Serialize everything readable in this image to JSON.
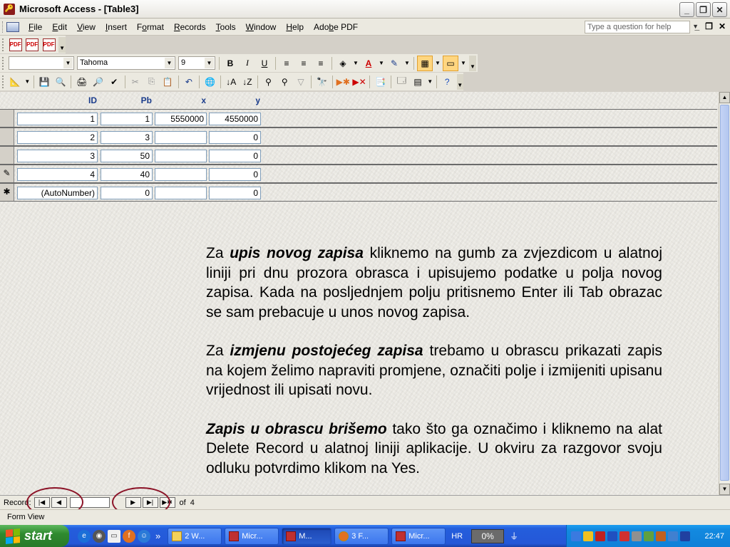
{
  "window": {
    "title": "Microsoft Access - [Table3]"
  },
  "menubar": {
    "items": [
      {
        "label": "File",
        "ul": "F",
        "rest": "ile"
      },
      {
        "label": "Edit",
        "ul": "E",
        "rest": "dit"
      },
      {
        "label": "View",
        "ul": "V",
        "rest": "iew"
      },
      {
        "label": "Insert",
        "ul": "I",
        "rest": "nsert"
      },
      {
        "label": "Format",
        "pre": "F",
        "ul": "o",
        "rest": "rmat"
      },
      {
        "label": "Records",
        "ul": "R",
        "rest": "ecords"
      },
      {
        "label": "Tools",
        "ul": "T",
        "rest": "ools"
      },
      {
        "label": "Window",
        "ul": "W",
        "rest": "indow"
      },
      {
        "label": "Help",
        "ul": "H",
        "rest": "elp"
      },
      {
        "label": "Adobe PDF",
        "pre": "Ado",
        "ul": "b",
        "rest": "e PDF"
      }
    ],
    "help_placeholder": "Type a question for help"
  },
  "format_toolbar": {
    "font": "Tahoma",
    "size": "9"
  },
  "table": {
    "columns": [
      "ID",
      "Pb",
      "x",
      "y"
    ],
    "rows": [
      {
        "selector": "",
        "ID": "1",
        "Pb": "1",
        "x": "5550000",
        "y": "4550000"
      },
      {
        "selector": "",
        "ID": "2",
        "Pb": "3",
        "x": "",
        "y": "0"
      },
      {
        "selector": "",
        "ID": "3",
        "Pb": "50",
        "x": "",
        "y": "0"
      },
      {
        "selector": "✎",
        "ID": "4",
        "Pb": "40",
        "x": "",
        "y": "0"
      },
      {
        "selector": "✱",
        "ID": "(AutoNumber)",
        "Pb": "0",
        "x": "",
        "y": "0"
      }
    ]
  },
  "info": {
    "p1_pre": "Za ",
    "p1_bold": "upis novog zapisa",
    "p1_post": " kliknemo na gumb za zvjezdicom u alatnoj liniji pri dnu prozora obrasca i upisujemo podatke u polja novog zapisa. Kada na posljednjem polju pritisnemo Enter ili Tab obrazac se sam prebacuje u unos novog zapisa.",
    "p2_pre": "Za ",
    "p2_bold": "izmjenu postojećeg zapisa",
    "p2_post": " trebamo u obrascu prikazati zapis na kojem želimo napraviti promjene, označiti polje i izmijeniti upisanu vrijednost ili upisati novu.",
    "p3_bold": "Zapis u obrascu brišemo",
    "p3_post": " tako što ga označimo i kliknemo na alat Delete Record u alatnoj liniji aplikacije. U okviru za razgovor svoju odluku potvrdimo klikom na Yes."
  },
  "navigator": {
    "label": "Record:",
    "current": "",
    "of_label": "of",
    "total": "4"
  },
  "status": {
    "text": "Form View"
  },
  "taskbar": {
    "start_label": "start",
    "tasks": [
      {
        "label": "2 W..."
      },
      {
        "label": "Micr..."
      },
      {
        "label": "M..."
      },
      {
        "label": "3 F..."
      },
      {
        "label": "Micr..."
      }
    ],
    "lang": "HR",
    "progress": "0%",
    "clock": "22:47"
  },
  "colors": {
    "accent": "#1a3c8c",
    "highlight_ring": "#8c1428",
    "taskbar": "#245edc"
  }
}
